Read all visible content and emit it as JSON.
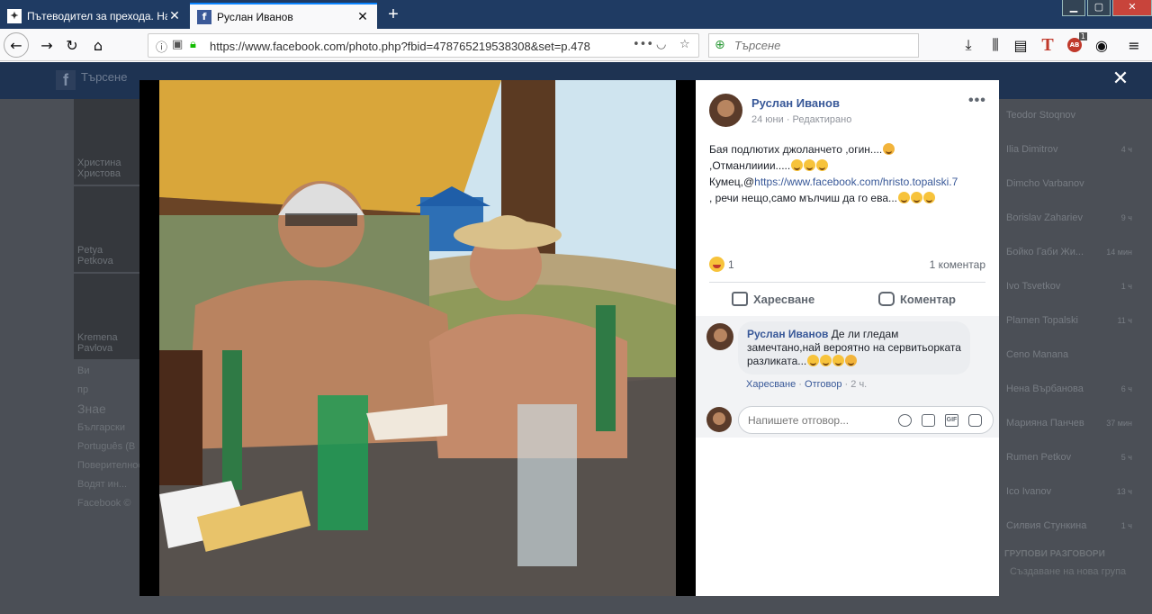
{
  "browser": {
    "tabs": [
      {
        "title": "Пътеводител за прехода. На с...",
        "favicon": "tour-icon"
      },
      {
        "title": "Руслан Иванов",
        "favicon": "facebook-icon"
      }
    ],
    "url": "https://www.facebook.com/photo.php?fbid=478765219538308&set=p.478",
    "search_placeholder": "Търсене",
    "addon_badge": "1",
    "addon_label": "AB"
  },
  "background": {
    "search": "Търсене",
    "left_cards": [
      "Христина Христова",
      "Petya Petkova",
      "Kremena Pavlova"
    ],
    "left_text": [
      "Ви",
      "пр",
      "Знае"
    ],
    "left_lines": [
      "Български",
      "Português (B",
      "Поверителност",
      "Водят ин...",
      "Facebook ©"
    ],
    "contacts": [
      {
        "name": "Teodor Stoqnov",
        "time": ""
      },
      {
        "name": "Ilia Dimitrov",
        "time": "4 ч"
      },
      {
        "name": "Dimcho Varbanov",
        "time": ""
      },
      {
        "name": "Borislav Zahariev",
        "time": "9 ч"
      },
      {
        "name": "Бойко Габи Жи...",
        "time": "14 мин"
      },
      {
        "name": "Ivo Tsvetkov",
        "time": "1 ч"
      },
      {
        "name": "Plamen Topalski",
        "time": "11 ч"
      },
      {
        "name": "Ceno Manana",
        "time": ""
      },
      {
        "name": "Нена Върбанова",
        "time": "6 ч"
      },
      {
        "name": "Марияна Панчев",
        "time": "37 мин"
      },
      {
        "name": "Rumen Petkov",
        "time": "5 ч"
      },
      {
        "name": "Ico Ivanov",
        "time": "13 ч"
      },
      {
        "name": "Силвия Стункина",
        "time": "1 ч"
      }
    ],
    "group_header": "ГРУПОВИ РАЗГОВОРИ",
    "new_group": "Създаване на нова група"
  },
  "post": {
    "author": "Руслан Иванов",
    "meta": "24 юни · Редактирано",
    "text_lines": [
      "Бая подлютих джоланчето ,огин....",
      ",Отманлииии.....",
      "Кумец,@",
      ", речи нещо,само мълчиш да го ева..."
    ],
    "link": "https://www.facebook.com/hristo.topalski.7",
    "reactions": "1",
    "comments_count": "1 коментар",
    "like_label": "Харесване",
    "comment_label": "Коментар"
  },
  "comment": {
    "author": "Руслан Иванов",
    "text": "Де ли гледам замечтано,най вероятно на сервитьорката разликата...",
    "like": "Харесване",
    "reply": "Отговор",
    "time": "2 ч."
  },
  "reply_placeholder": "Напишете отговор...",
  "colors": {
    "fb_blue": "#385898",
    "tabbar": "#1f3b63",
    "overlay": "#4b4f56"
  }
}
